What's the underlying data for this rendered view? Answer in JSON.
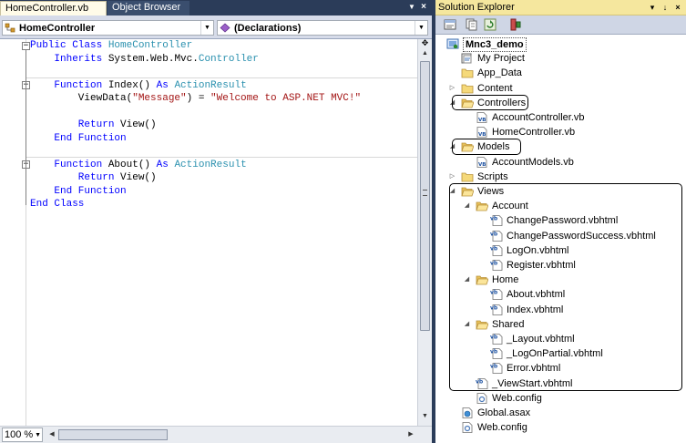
{
  "editor": {
    "tabs": [
      {
        "label": "HomeController.vb",
        "active": true
      },
      {
        "label": "Object Browser",
        "active": false
      }
    ],
    "class_combo": "HomeController",
    "members_combo": "(Declarations)",
    "zoom": "100 %",
    "code_lines": [
      [
        {
          "t": "Public Class ",
          "c": "kw"
        },
        {
          "t": "HomeController",
          "c": "ty"
        }
      ],
      [
        {
          "t": "    Inherits ",
          "c": "kw"
        },
        {
          "t": "System.Web.Mvc.",
          "c": ""
        },
        {
          "t": "Controller",
          "c": "ty"
        }
      ],
      [],
      [
        {
          "t": "    Function ",
          "c": "kw"
        },
        {
          "t": "Index() ",
          "c": ""
        },
        {
          "t": "As ",
          "c": "kw"
        },
        {
          "t": "ActionResult",
          "c": "ty"
        }
      ],
      [
        {
          "t": "        ViewData(",
          "c": ""
        },
        {
          "t": "\"Message\"",
          "c": "str"
        },
        {
          "t": ") = ",
          "c": ""
        },
        {
          "t": "\"Welcome to ASP.NET MVC!\"",
          "c": "str"
        }
      ],
      [],
      [
        {
          "t": "        Return ",
          "c": "kw"
        },
        {
          "t": "View()",
          "c": ""
        }
      ],
      [
        {
          "t": "    End Function",
          "c": "kw"
        }
      ],
      [],
      [
        {
          "t": "    Function ",
          "c": "kw"
        },
        {
          "t": "About() ",
          "c": ""
        },
        {
          "t": "As ",
          "c": "kw"
        },
        {
          "t": "ActionResult",
          "c": "ty"
        }
      ],
      [
        {
          "t": "        Return ",
          "c": "kw"
        },
        {
          "t": "View()",
          "c": ""
        }
      ],
      [
        {
          "t": "    End Function",
          "c": "kw"
        }
      ],
      [
        {
          "t": "End Class",
          "c": "kw"
        }
      ]
    ]
  },
  "solution_explorer": {
    "title": "Solution Explorer",
    "pin_glyph": "↓",
    "close_glyph": "×",
    "dropdown_glyph": "▾",
    "nodes": [
      {
        "label": "Mnc3_demo",
        "level": 0,
        "icon": "project",
        "bold": true,
        "boxed": true
      },
      {
        "label": "My Project",
        "level": 1,
        "icon": "myproject"
      },
      {
        "label": "App_Data",
        "level": 1,
        "icon": "folder"
      },
      {
        "label": "Content",
        "level": 1,
        "icon": "folder",
        "exp": "collapsed"
      },
      {
        "label": "Controllers",
        "level": 1,
        "icon": "folder-open",
        "exp": "expanded"
      },
      {
        "label": "AccountController.vb",
        "level": 2,
        "icon": "vb"
      },
      {
        "label": "HomeController.vb",
        "level": 2,
        "icon": "vb"
      },
      {
        "label": "Models",
        "level": 1,
        "icon": "folder-open",
        "exp": "expanded"
      },
      {
        "label": "AccountModels.vb",
        "level": 2,
        "icon": "vb"
      },
      {
        "label": "Scripts",
        "level": 1,
        "icon": "folder",
        "exp": "collapsed"
      },
      {
        "label": "Views",
        "level": 1,
        "icon": "folder-open",
        "exp": "expanded"
      },
      {
        "label": "Account",
        "level": 2,
        "icon": "folder-open",
        "exp": "expanded"
      },
      {
        "label": "ChangePassword.vbhtml",
        "level": 3,
        "icon": "vbhtml"
      },
      {
        "label": "ChangePasswordSuccess.vbhtml",
        "level": 3,
        "icon": "vbhtml"
      },
      {
        "label": "LogOn.vbhtml",
        "level": 3,
        "icon": "vbhtml"
      },
      {
        "label": "Register.vbhtml",
        "level": 3,
        "icon": "vbhtml"
      },
      {
        "label": "Home",
        "level": 2,
        "icon": "folder-open",
        "exp": "expanded"
      },
      {
        "label": "About.vbhtml",
        "level": 3,
        "icon": "vbhtml"
      },
      {
        "label": "Index.vbhtml",
        "level": 3,
        "icon": "vbhtml"
      },
      {
        "label": "Shared",
        "level": 2,
        "icon": "folder-open",
        "exp": "expanded"
      },
      {
        "label": "_Layout.vbhtml",
        "level": 3,
        "icon": "vbhtml"
      },
      {
        "label": "_LogOnPartial.vbhtml",
        "level": 3,
        "icon": "vbhtml"
      },
      {
        "label": "Error.vbhtml",
        "level": 3,
        "icon": "vbhtml"
      },
      {
        "label": "_ViewStart.vbhtml",
        "level": 2,
        "icon": "vbhtml"
      },
      {
        "label": "Web.config",
        "level": 2,
        "icon": "config"
      },
      {
        "label": "Global.asax",
        "level": 1,
        "icon": "global"
      },
      {
        "label": "Web.config",
        "level": 1,
        "icon": "config"
      }
    ]
  },
  "colors": {
    "chrome_dark": "#2b3c59",
    "tool_title": "#f5e79e",
    "keyword": "#0000ff",
    "type": "#2b91af",
    "string": "#a31515"
  }
}
